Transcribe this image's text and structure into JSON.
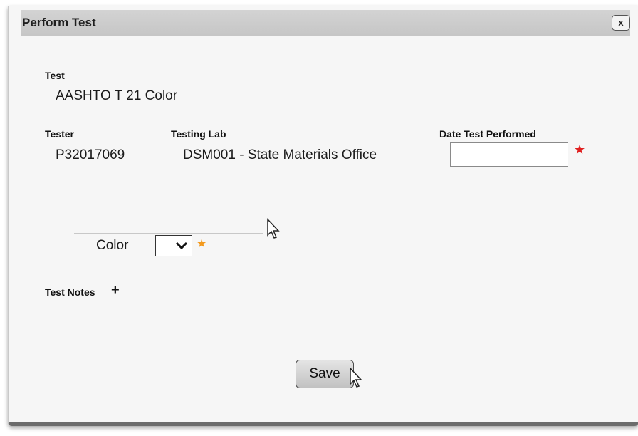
{
  "dialog": {
    "title": "Perform Test",
    "close_label": "x"
  },
  "test": {
    "label": "Test",
    "value": "AASHTO T 21 Color"
  },
  "tester": {
    "label": "Tester",
    "value": "P32017069"
  },
  "testing_lab": {
    "label": "Testing Lab",
    "value": "DSM001 - State Materials Office"
  },
  "date_performed": {
    "label": "Date Test Performed",
    "value": "",
    "required_mark": "★"
  },
  "color": {
    "label": "Color",
    "selected": "",
    "required_mark": "★"
  },
  "test_notes": {
    "label": "Test Notes",
    "add_symbol": "+"
  },
  "actions": {
    "save_label": "Save"
  },
  "colors": {
    "required_red": "#e02020",
    "required_orange": "#f39a1e",
    "titlebar": "#cccccc"
  }
}
